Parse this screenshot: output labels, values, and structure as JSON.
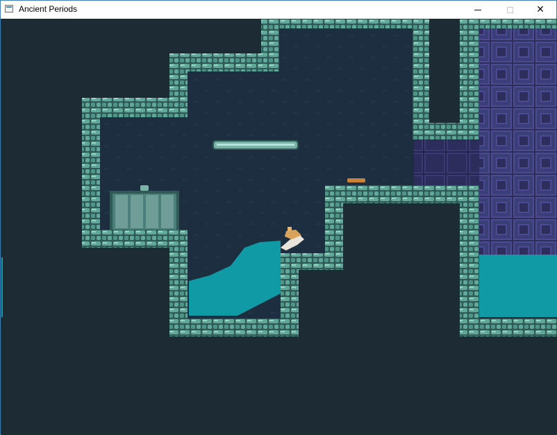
{
  "window": {
    "title": "Ancient Periods",
    "minimize_icon": "minimize-icon",
    "maximize_icon": "maximize-icon",
    "close_icon": "close-icon",
    "close_glyph": "✕"
  },
  "game": {
    "colors": {
      "background": "#1d2b35",
      "cave_interior": "#1c2e40",
      "wall_stone": "#5fa89a",
      "wall_stone_light": "#9cd4c4",
      "wall_stone_dark": "#2f5a55",
      "water": "#0f9aa6",
      "purple_block": "#3a3f78",
      "door": "#4c7f79",
      "platform": "#7bb3a8"
    },
    "objects": [
      "player-character",
      "floating-platform",
      "double-door",
      "pressure-plate",
      "water-pool-left",
      "water-pool-right",
      "purple-block-wall"
    ]
  }
}
